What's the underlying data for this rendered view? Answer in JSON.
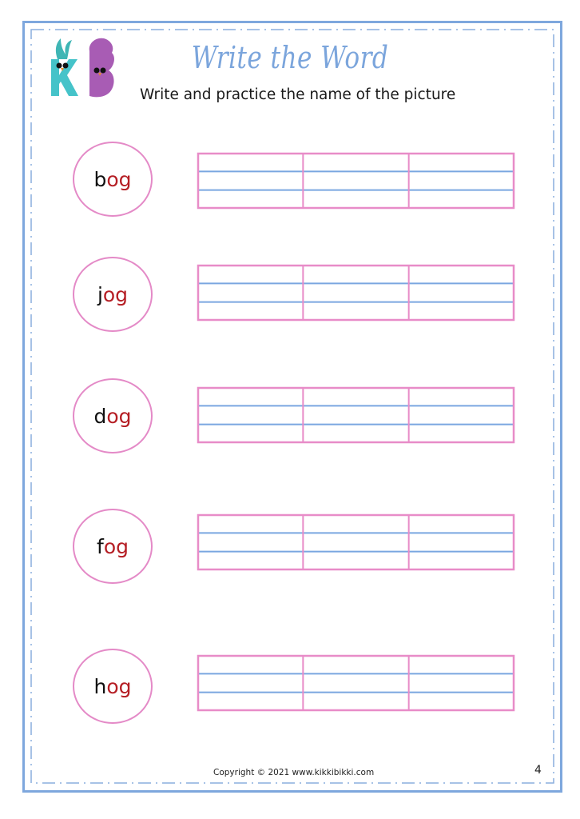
{
  "header": {
    "logo": "kikkibikki-kb-logo",
    "title": "Write the Word",
    "subtitle": "Write and practice the name of the picture"
  },
  "words": [
    {
      "first": "b",
      "rest": "og",
      "full": "bog"
    },
    {
      "first": "j",
      "rest": "og",
      "full": "jog"
    },
    {
      "first": "d",
      "rest": "og",
      "full": "dog"
    },
    {
      "first": "f",
      "rest": "og",
      "full": "fog"
    },
    {
      "first": "h",
      "rest": "og",
      "full": "hog"
    }
  ],
  "writing_grid": {
    "columns": 3,
    "guide_lines": 2
  },
  "footer": {
    "copyright": "Copyright © 2021 www.kikkibikki.com",
    "page_number": "4"
  },
  "colors": {
    "border_blue": "#7ea7dd",
    "circle_pink": "#e48ac7",
    "grid_pink": "#e88cc8",
    "guide_blue": "#7aa6e0",
    "word_ending_red": "#b51e24",
    "title_blue": "#7ba5dc"
  }
}
